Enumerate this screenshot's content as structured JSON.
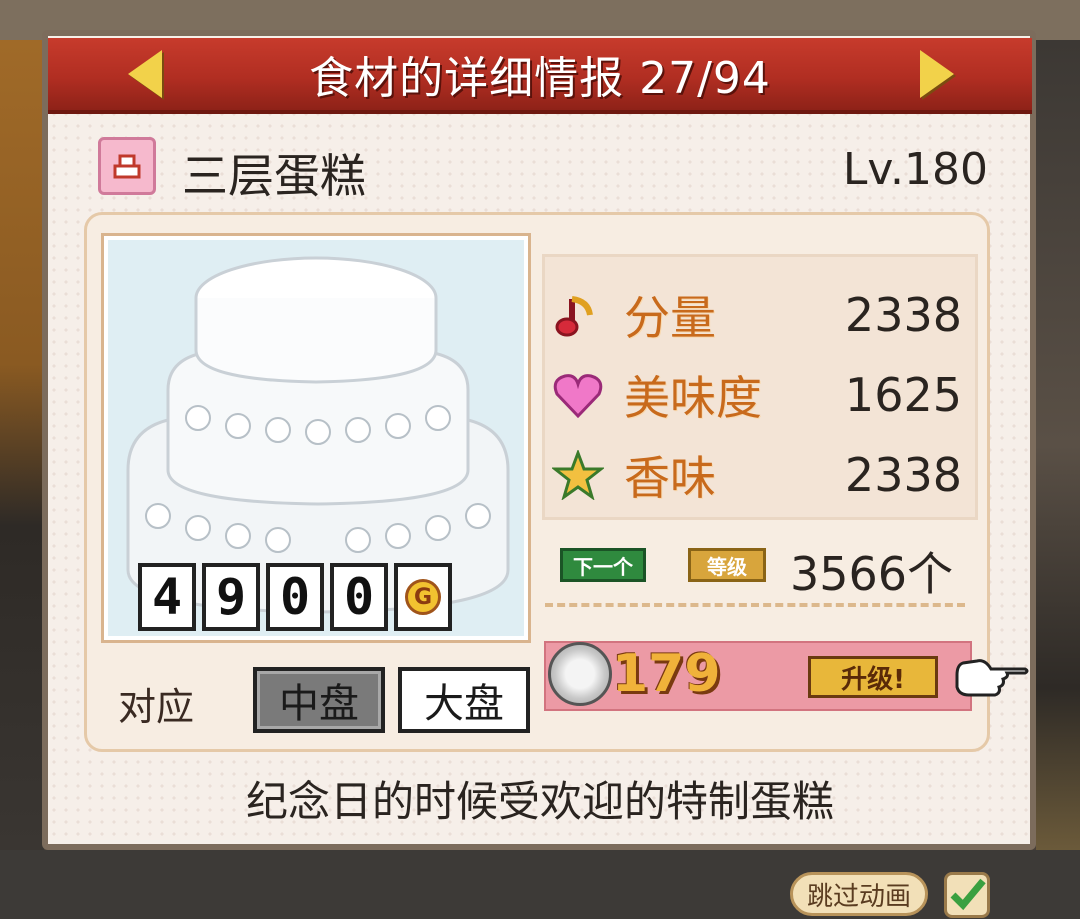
{
  "header": {
    "title": "食材的详细情报 27/94"
  },
  "ingredient": {
    "name": "三层蛋糕",
    "level": "Lv.180",
    "price_digits": [
      "4",
      "9",
      "0",
      "0"
    ],
    "price_unit": "G"
  },
  "sizes": {
    "label": "对应",
    "medium": "中盘",
    "large": "大盘"
  },
  "stats": [
    {
      "label": "分量",
      "value": "2338",
      "icon": "music-note-icon"
    },
    {
      "label": "美味度",
      "value": "1625",
      "icon": "heart-icon"
    },
    {
      "label": "香味",
      "value": "2338",
      "icon": "star-icon"
    }
  ],
  "next_level": {
    "next_tag": "下一个",
    "level_tag": "等级",
    "count": "3566个"
  },
  "upgrade": {
    "cost": "179",
    "button": "升级!"
  },
  "description": "纪念日的时候受欢迎的特制蛋糕",
  "footer": {
    "skip_label": "跳过动画"
  },
  "colors": {
    "title_bar": "#b12e22",
    "stat_label": "#c86a1c",
    "upgrade_bar": "#ec9aa5",
    "accent_gold": "#f0b23a"
  }
}
